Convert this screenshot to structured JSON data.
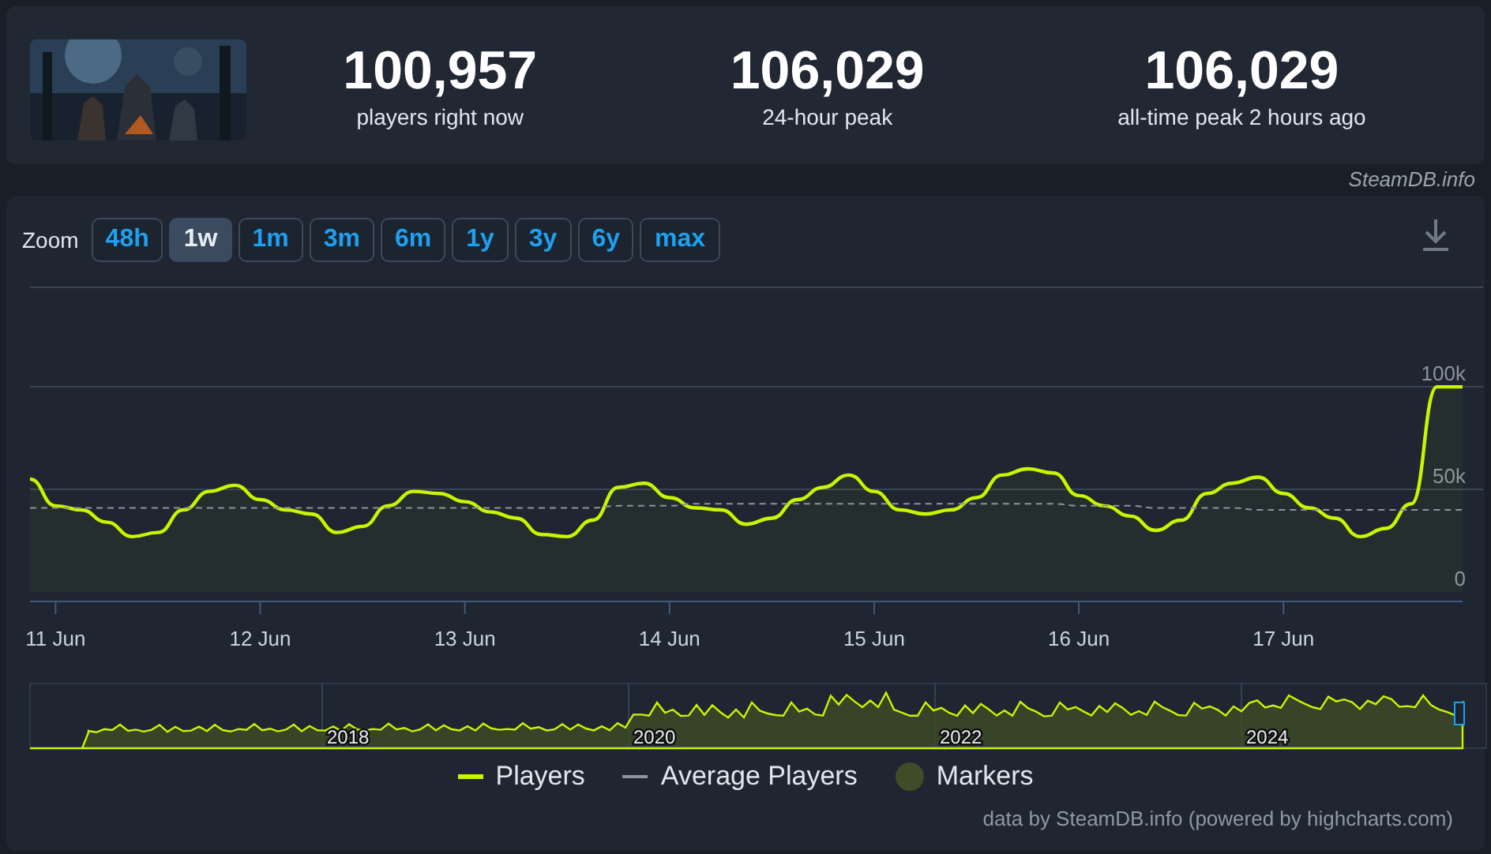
{
  "header": {
    "stats": [
      {
        "value": "100,957",
        "label": "players right now"
      },
      {
        "value": "106,029",
        "label": "24-hour peak"
      },
      {
        "value": "106,029",
        "label": "all-time peak 2 hours ago"
      }
    ],
    "credit": "SteamDB.info"
  },
  "chart_panel": {
    "zoom_label": "Zoom",
    "zoom_buttons": [
      {
        "label": "48h",
        "selected": false
      },
      {
        "label": "1w",
        "selected": true
      },
      {
        "label": "1m",
        "selected": false
      },
      {
        "label": "3m",
        "selected": false
      },
      {
        "label": "6m",
        "selected": false
      },
      {
        "label": "1y",
        "selected": false
      },
      {
        "label": "3y",
        "selected": false
      },
      {
        "label": "6y",
        "selected": false
      },
      {
        "label": "max",
        "selected": false
      }
    ],
    "chart_data": {
      "type": "area",
      "categories": [
        null,
        "11 Jun",
        null,
        null,
        null,
        null,
        null,
        null,
        null,
        "12 Jun",
        null,
        null,
        null,
        null,
        null,
        null,
        null,
        "13 Jun",
        null,
        null,
        null,
        null,
        null,
        null,
        null,
        "14 Jun",
        null,
        null,
        null,
        null,
        null,
        null,
        null,
        "15 Jun",
        null,
        null,
        null,
        null,
        null,
        null,
        null,
        "16 Jun",
        null,
        null,
        null,
        null,
        null,
        null,
        null,
        "17 Jun",
        null,
        null,
        null,
        null,
        null,
        null,
        null
      ],
      "series": [
        {
          "name": "Players",
          "color": "#c8f500",
          "values": [
            55000,
            42000,
            40000,
            34000,
            27000,
            29000,
            40000,
            49000,
            52000,
            45000,
            40000,
            38000,
            29000,
            32000,
            42000,
            49000,
            48000,
            44000,
            39000,
            36000,
            28000,
            27000,
            35000,
            51000,
            53000,
            46000,
            41000,
            40000,
            33000,
            36000,
            45000,
            51000,
            57000,
            49000,
            40000,
            38000,
            40000,
            46000,
            57000,
            60000,
            58000,
            47000,
            42000,
            37000,
            30000,
            35000,
            48000,
            53000,
            56000,
            48000,
            41000,
            36000,
            27000,
            31000,
            43000,
            100000,
            100000
          ]
        },
        {
          "name": "Average Players",
          "color": "#8a939e",
          "type": "line",
          "line_style": "dashed",
          "values": [
            41000,
            41000,
            41000,
            41000,
            41000,
            41000,
            41000,
            41000,
            41000,
            41000,
            41000,
            41000,
            41000,
            41000,
            41000,
            41000,
            41000,
            41000,
            41000,
            41000,
            41000,
            41000,
            41000,
            42000,
            42000,
            42000,
            43000,
            43000,
            43000,
            43000,
            43000,
            43000,
            43000,
            43000,
            43000,
            43000,
            43000,
            43000,
            43000,
            43000,
            43000,
            42000,
            42000,
            42000,
            41000,
            41000,
            41000,
            41000,
            40000,
            40000,
            40000,
            40000,
            40000,
            40000,
            40000,
            40000,
            40000
          ]
        }
      ],
      "yticks": [
        {
          "value": 0,
          "label": "0"
        },
        {
          "value": 50000,
          "label": "50k"
        },
        {
          "value": 100000,
          "label": "100k"
        }
      ],
      "ylim": [
        0,
        195000
      ]
    },
    "navigator": {
      "years": [
        "2018",
        "2020",
        "2022",
        "2024"
      ]
    },
    "markers_legend": {
      "label": "Markers",
      "color": "#3e4c27"
    },
    "footer": "data by SteamDB.info (powered by highcharts.com)"
  }
}
